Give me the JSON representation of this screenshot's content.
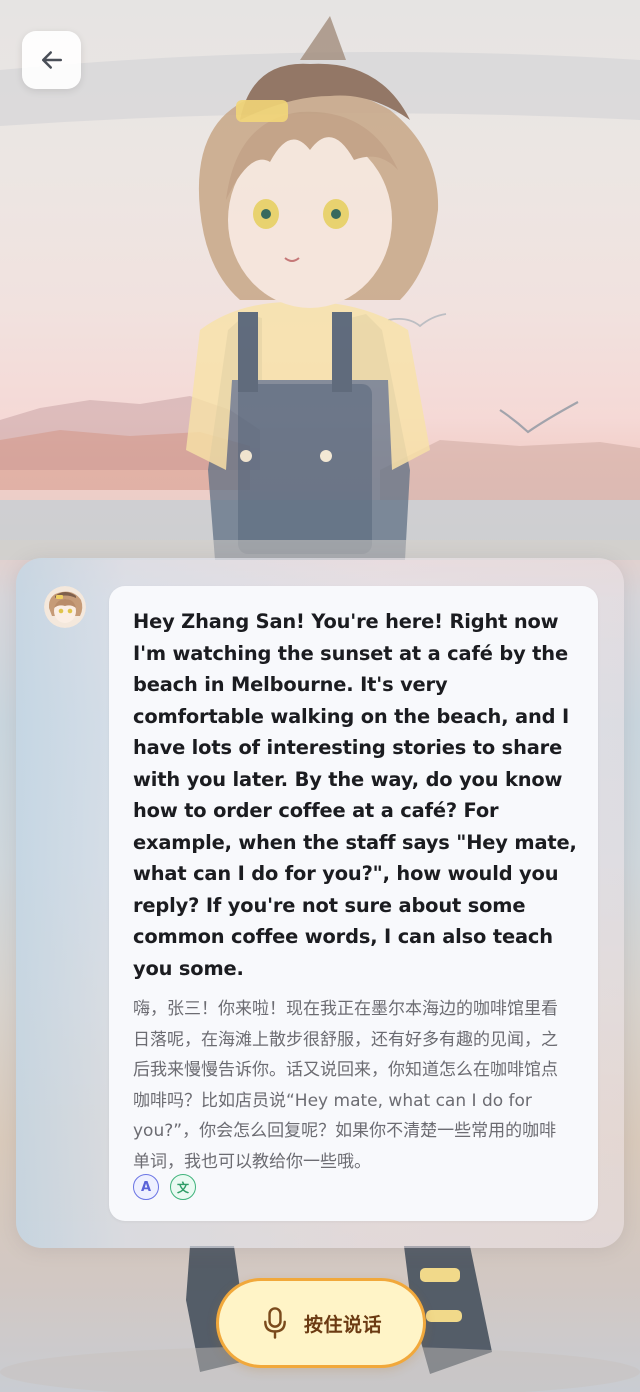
{
  "header": {
    "back_icon": "arrow-left-icon"
  },
  "character": {
    "avatar_icon": "character-avatar"
  },
  "message": {
    "english": "Hey Zhang San! You're here! Right now I'm watching the sunset at a café by the beach in Melbourne. It's very comfortable walking on the beach, and I have lots of interesting stories to share with you later. By the way, do you know how to order coffee at a café? For example, when the staff says \"Hey mate, what can I do for you?\", how would you reply? If you're not sure about some common coffee words, I can also teach you some.",
    "chinese": "嗨，张三！你来啦！现在我正在墨尔本海边的咖啡馆里看日落呢，在海滩上散步很舒服，还有好多有趣的见闻，之后我来慢慢告诉你。话又说回来，你知道怎么在咖啡馆点咖啡吗？比如店员说“Hey mate, what can I do for you?”，你会怎么回复呢？如果你不清楚一些常用的咖啡单词，我也可以教给你一些哦。",
    "lang_buttons": {
      "english": "A",
      "chinese": "文"
    }
  },
  "talk_button": {
    "label": "按住说话",
    "icon": "microphone-icon"
  },
  "colors": {
    "accent_orange": "#f1a83b",
    "talk_bg": "#fff4c7",
    "english_badge": "#6a74e4",
    "chinese_badge": "#3fb37b"
  }
}
